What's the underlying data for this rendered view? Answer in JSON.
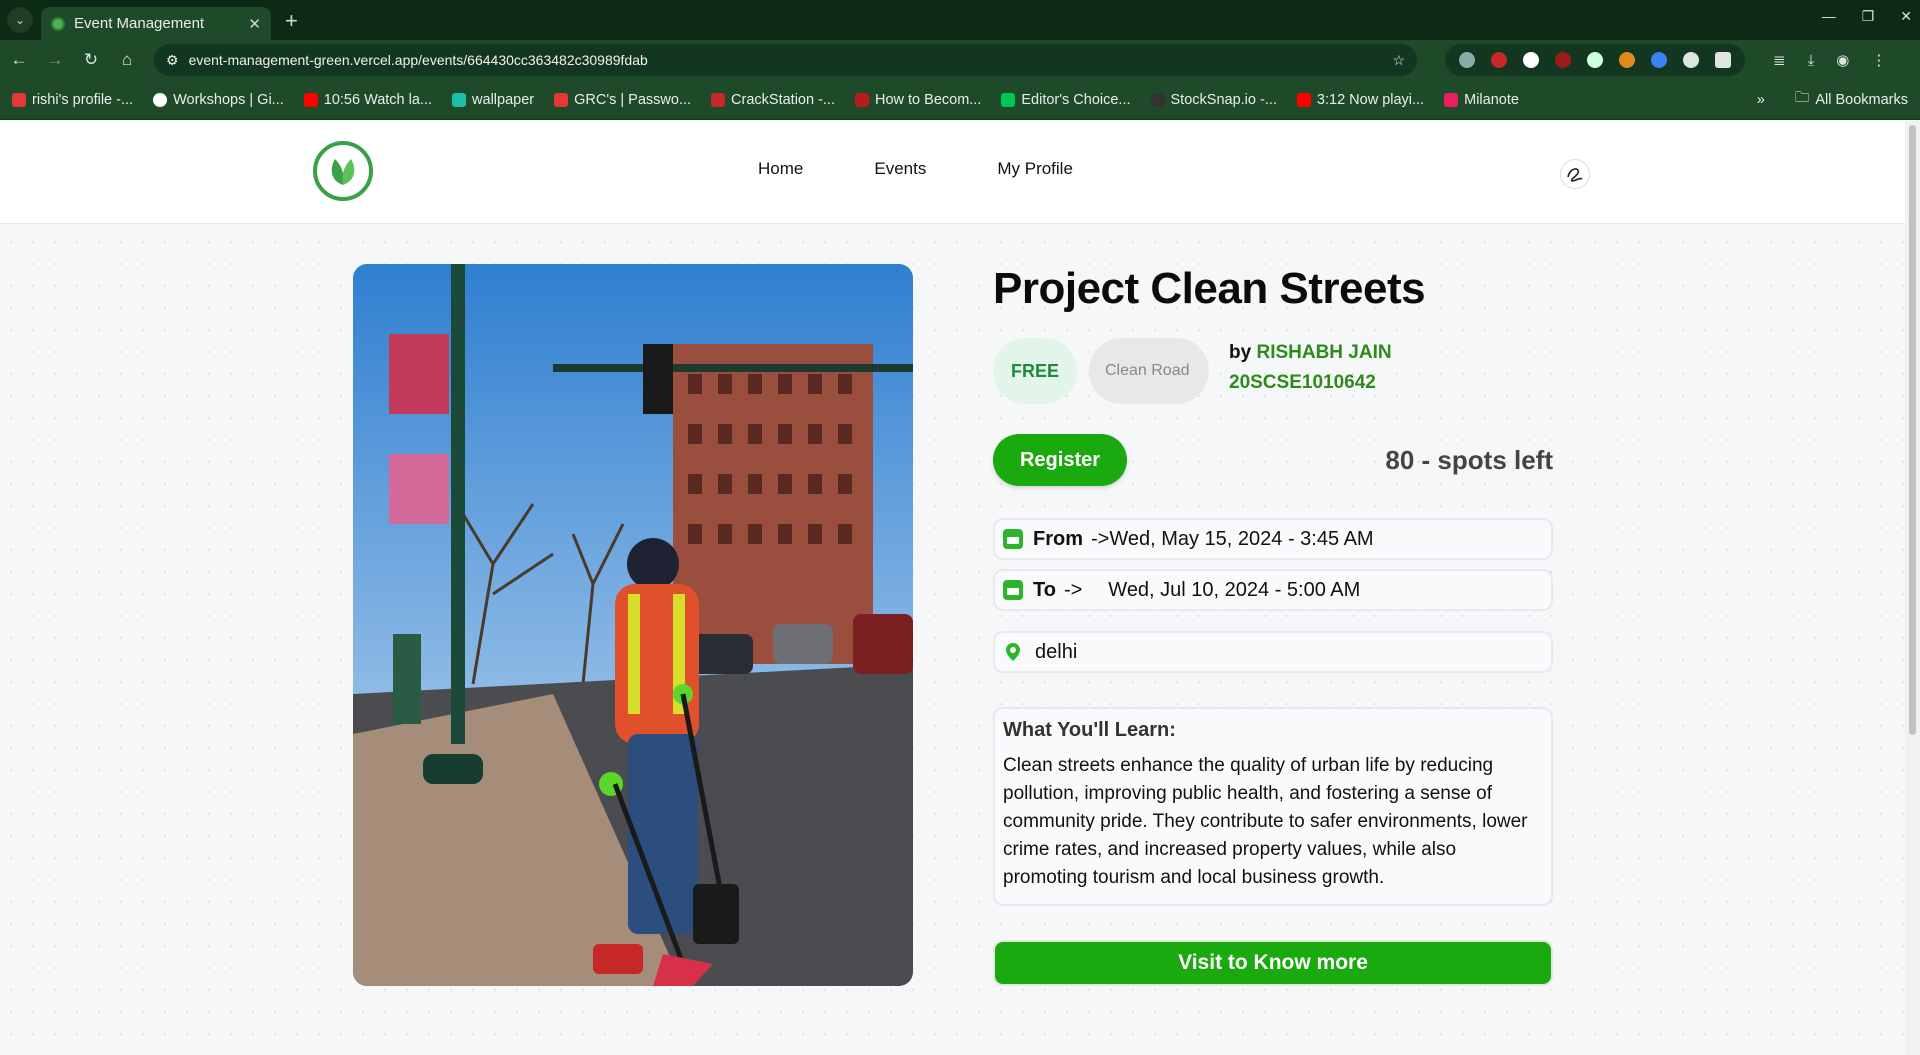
{
  "browser": {
    "tab_title": "Event Management",
    "url": "event-management-green.vercel.app/events/664430cc363482c30989fdab",
    "bookmarks": [
      {
        "label": "rishi's profile -...",
        "color": "#e53935"
      },
      {
        "label": "Workshops | Gi...",
        "color": "#ffffff"
      },
      {
        "label": "10:56 Watch la...",
        "color": "#ff0000"
      },
      {
        "label": "wallpaper",
        "color": "#1bbfa8"
      },
      {
        "label": "GRC's | Passwo...",
        "color": "#e53935"
      },
      {
        "label": "CrackStation -...",
        "color": "#c62828"
      },
      {
        "label": "How to Becom...",
        "color": "#b71c1c"
      },
      {
        "label": "Editor's Choice...",
        "color": "#00c853"
      },
      {
        "label": "StockSnap.io -...",
        "color": "#333333"
      },
      {
        "label": "3:12 Now playi...",
        "color": "#ff0000"
      },
      {
        "label": "Milanote",
        "color": "#e91e63"
      }
    ],
    "all_bookmarks": "All Bookmarks"
  },
  "nav": {
    "home": "Home",
    "events": "Events",
    "profile": "My Profile"
  },
  "event": {
    "title": "Project Clean Streets",
    "price_badge": "FREE",
    "category": "Clean Road",
    "by_prefix": "by",
    "organizer_name": "RISHABH JAIN",
    "organizer_id": "20SCSE1010642",
    "register_label": "Register",
    "spots_left": "80 - spots left",
    "from_label": "From",
    "from_arrow": "->",
    "from_date": "Wed, May 15, 2024 - 3:45 AM",
    "to_label": "To",
    "to_arrow": "->",
    "to_date": "Wed, Jul 10, 2024 - 5:00 AM",
    "location": "delhi",
    "learn_title": "What You'll Learn:",
    "learn_text": "Clean streets enhance the quality of urban life by reducing pollution, improving public health, and fostering a sense of community pride. They contribute to safer environments, lower crime rates, and increased property values, while also promoting tourism and local business growth.",
    "visit_label": "Visit to Know more"
  },
  "colors": {
    "accent": "#1aa90f",
    "organizer": "#2c8b1b",
    "chrome": "#1f4a2a"
  }
}
